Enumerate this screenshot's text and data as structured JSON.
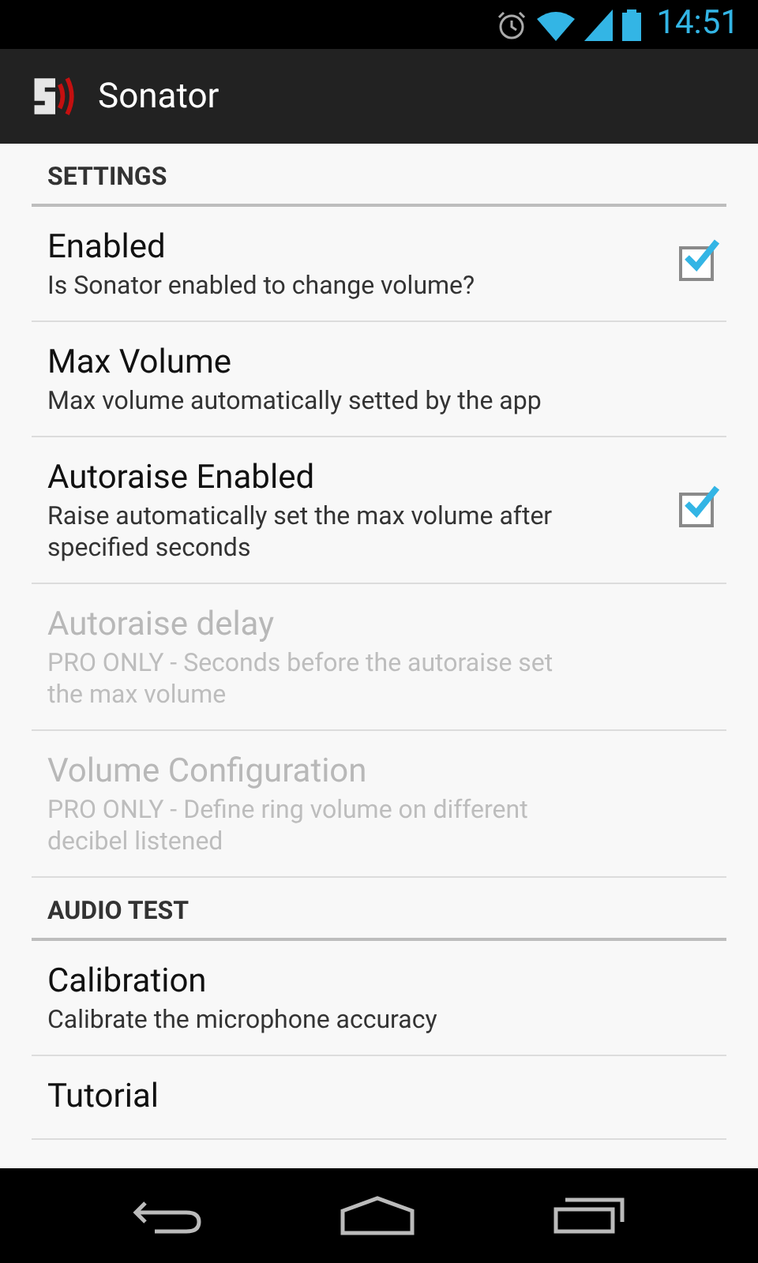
{
  "status_bar": {
    "time": "14:51"
  },
  "app_bar": {
    "title": "Sonator"
  },
  "sections": [
    {
      "title": "SETTINGS",
      "items": [
        {
          "kind": "checkbox",
          "title": "Enabled",
          "summary": "Is Sonator enabled to change volume?",
          "disabled": false,
          "checked": true
        },
        {
          "kind": "plain",
          "title": "Max Volume",
          "summary": "Max volume automatically setted by the app",
          "disabled": false
        },
        {
          "kind": "checkbox",
          "title": "Autoraise Enabled",
          "summary": "Raise automatically set the max volume after specified seconds",
          "disabled": false,
          "checked": true
        },
        {
          "kind": "plain",
          "title": "Autoraise delay",
          "summary": "PRO ONLY - Seconds before the autoraise set the max volume",
          "disabled": true
        },
        {
          "kind": "plain",
          "title": "Volume Configuration",
          "summary": "PRO ONLY - Define ring volume on different decibel listened",
          "disabled": true
        }
      ]
    },
    {
      "title": "AUDIO TEST",
      "items": [
        {
          "kind": "plain",
          "title": "Calibration",
          "summary": "Calibrate the microphone accuracy",
          "disabled": false
        },
        {
          "kind": "plain",
          "title": "Tutorial",
          "disabled": false
        }
      ]
    }
  ]
}
